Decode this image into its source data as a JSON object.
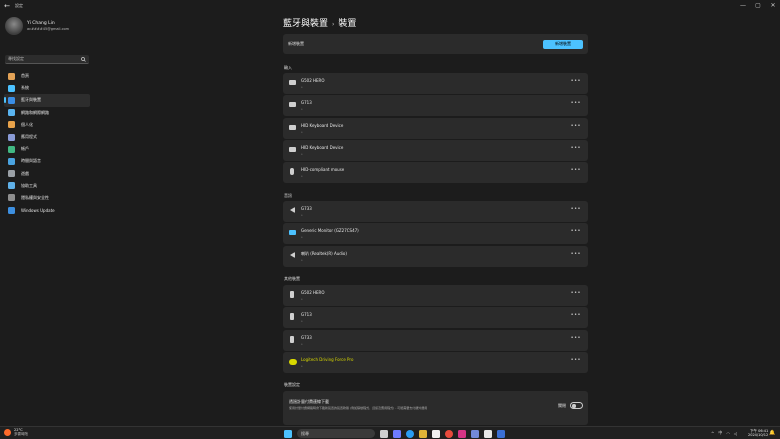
{
  "window": {
    "title": "設定",
    "back_glyph": "←",
    "minimize_glyph": "—",
    "maximize_glyph": "▢",
    "close_glyph": "✕"
  },
  "profile": {
    "name": "Yi Chang Lin",
    "email": "ac####45@gmail.com"
  },
  "search": {
    "placeholder": "尋找設定",
    "icon": "search-icon"
  },
  "sidebar": {
    "items": [
      {
        "label": "首頁",
        "icon": "home-icon",
        "color": "#e3a256",
        "active": false
      },
      {
        "label": "系統",
        "icon": "system-icon",
        "color": "#4cc2ff",
        "active": false
      },
      {
        "label": "藍牙與裝置",
        "icon": "bluetooth-devices-icon",
        "color": "#3a8ee6",
        "active": true
      },
      {
        "label": "網路和網際網路",
        "icon": "network-icon",
        "color": "#5ab4f0",
        "active": false
      },
      {
        "label": "個人化",
        "icon": "personalization-icon",
        "color": "#e8a24a",
        "active": false
      },
      {
        "label": "應用程式",
        "icon": "apps-icon",
        "color": "#8a9bd6",
        "active": false
      },
      {
        "label": "帳戶",
        "icon": "accounts-icon",
        "color": "#41b883",
        "active": false
      },
      {
        "label": "時間與語言",
        "icon": "time-language-icon",
        "color": "#4aa3e0",
        "active": false
      },
      {
        "label": "遊戲",
        "icon": "gaming-icon",
        "color": "#9aa0a6",
        "active": false
      },
      {
        "label": "協助工具",
        "icon": "accessibility-icon",
        "color": "#5fb0e8",
        "active": false
      },
      {
        "label": "隱私權與安全性",
        "icon": "privacy-shield-icon",
        "color": "#8e8e8e",
        "active": false
      },
      {
        "label": "Windows Update",
        "icon": "windows-update-icon",
        "color": "#3d8fe0",
        "active": false
      }
    ]
  },
  "breadcrumb": {
    "parent": "藍牙與裝置",
    "separator": "›",
    "current": "裝置"
  },
  "add_device": {
    "label": "新增裝置",
    "button": "新增裝置"
  },
  "sections": {
    "input": {
      "title": "輸入",
      "devices": [
        {
          "name": "G502 HERO",
          "status": "•",
          "icon": "keyboard-icon"
        },
        {
          "name": "G713",
          "status": "•",
          "icon": "keyboard-icon"
        },
        {
          "name": "HID Keyboard Device",
          "status": "•",
          "icon": "keyboard-icon"
        },
        {
          "name": "HID Keyboard Device",
          "status": "•",
          "icon": "keyboard-icon"
        },
        {
          "name": "HID-compliant mouse",
          "status": "•",
          "icon": "mouse-icon"
        }
      ]
    },
    "audio": {
      "title": "音訊",
      "devices": [
        {
          "name": "G733",
          "status": "•",
          "icon": "speaker-icon"
        },
        {
          "name": "Generic Monitor (GZ27CS47)",
          "status": "•",
          "icon": "monitor-icon"
        },
        {
          "name": "喇叭 (Realtek(R) Audio)",
          "status": "•",
          "icon": "speaker-icon"
        }
      ]
    },
    "other": {
      "title": "其他裝置",
      "devices": [
        {
          "name": "G502 HERO",
          "status": "•",
          "icon": "device-icon"
        },
        {
          "name": "G713",
          "status": "•",
          "icon": "device-icon"
        },
        {
          "name": "G733",
          "status": "•",
          "icon": "device-icon"
        },
        {
          "name": "Logitech Driving Force Pro",
          "status": "•",
          "icon": "steering-wheel-icon"
        }
      ]
    }
  },
  "more_glyph": "•••",
  "device_settings": {
    "title": "裝置設定",
    "card_title": "透過計量付費連線下載",
    "card_desc": "使用計量付費網路時會下載新裝置的裝置軟體 (例如驅動程式、資訊及應用程式) - 可能需要支付額外費用",
    "toggle_label": "關閉",
    "toggle_on": false
  },
  "taskbar": {
    "weather_temp": "22°C",
    "weather_cond": "多雲時陰",
    "search_placeholder": "搜尋",
    "tray_chevron": "^",
    "tray_lang": "中",
    "time": "下午 06:41",
    "date": "2024/10/12",
    "bell": "🔔",
    "windows_color": "#4cc2ff"
  }
}
